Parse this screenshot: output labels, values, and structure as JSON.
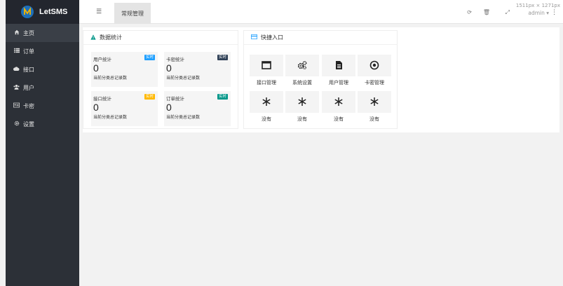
{
  "app": {
    "name": "LetSMS"
  },
  "sidebar": {
    "items": [
      {
        "label": "主页",
        "icon": "home-icon",
        "active": true
      },
      {
        "label": "订单",
        "icon": "list-icon"
      },
      {
        "label": "接口",
        "icon": "cloud-icon"
      },
      {
        "label": "用户",
        "icon": "users-icon"
      },
      {
        "label": "卡密",
        "icon": "id-card-icon"
      },
      {
        "label": "设置",
        "icon": "gear-icon"
      }
    ]
  },
  "topbar": {
    "tab_label": "常规管理",
    "size_readout": "1511px × 1271px",
    "user": "admin"
  },
  "stats_card": {
    "title": "数据统计",
    "items": [
      {
        "title": "用户统计",
        "badge": "实时",
        "badge_color": "#1e9fff",
        "value": "0",
        "desc": "当前分类总记录数"
      },
      {
        "title": "卡密统计",
        "badge": "实时",
        "badge_color": "#2f4056",
        "value": "0",
        "desc": "当前分类总记录数"
      },
      {
        "title": "接口统计",
        "badge": "实时",
        "badge_color": "#ffb800",
        "value": "0",
        "desc": "当前分类总记录数"
      },
      {
        "title": "订单统计",
        "badge": "实时",
        "badge_color": "#009688",
        "value": "0",
        "desc": "当前分类总记录数"
      }
    ]
  },
  "quick_card": {
    "title": "快捷入口",
    "items": [
      {
        "label": "接口管理",
        "icon": "window-icon"
      },
      {
        "label": "系统设置",
        "icon": "gears-icon"
      },
      {
        "label": "用户管理",
        "icon": "document-icon"
      },
      {
        "label": "卡密管理",
        "icon": "target-icon"
      },
      {
        "label": "没有",
        "icon": "snowflake-icon"
      },
      {
        "label": "没有",
        "icon": "snowflake-icon"
      },
      {
        "label": "没有",
        "icon": "snowflake-icon"
      },
      {
        "label": "没有",
        "icon": "snowflake-icon"
      }
    ]
  },
  "colors": {
    "sidebar_bg": "#2c3037",
    "logo_bg": "#23262e",
    "warning": "#009688",
    "quick_icon": "#1e9fff"
  }
}
